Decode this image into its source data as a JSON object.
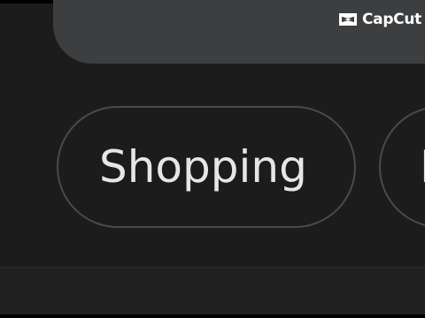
{
  "chips": [
    {
      "label": "Shopping"
    },
    {
      "label": "F"
    }
  ],
  "watermark": {
    "text": "CapCut"
  },
  "colors": {
    "background": "#1c1c1c",
    "search_box": "#3c3e40",
    "chip_border": "#4a4a4a",
    "chip_text": "#e6e6e6"
  },
  "icons": {
    "search": "search-icon",
    "watermark": "capcut-logo-icon"
  }
}
